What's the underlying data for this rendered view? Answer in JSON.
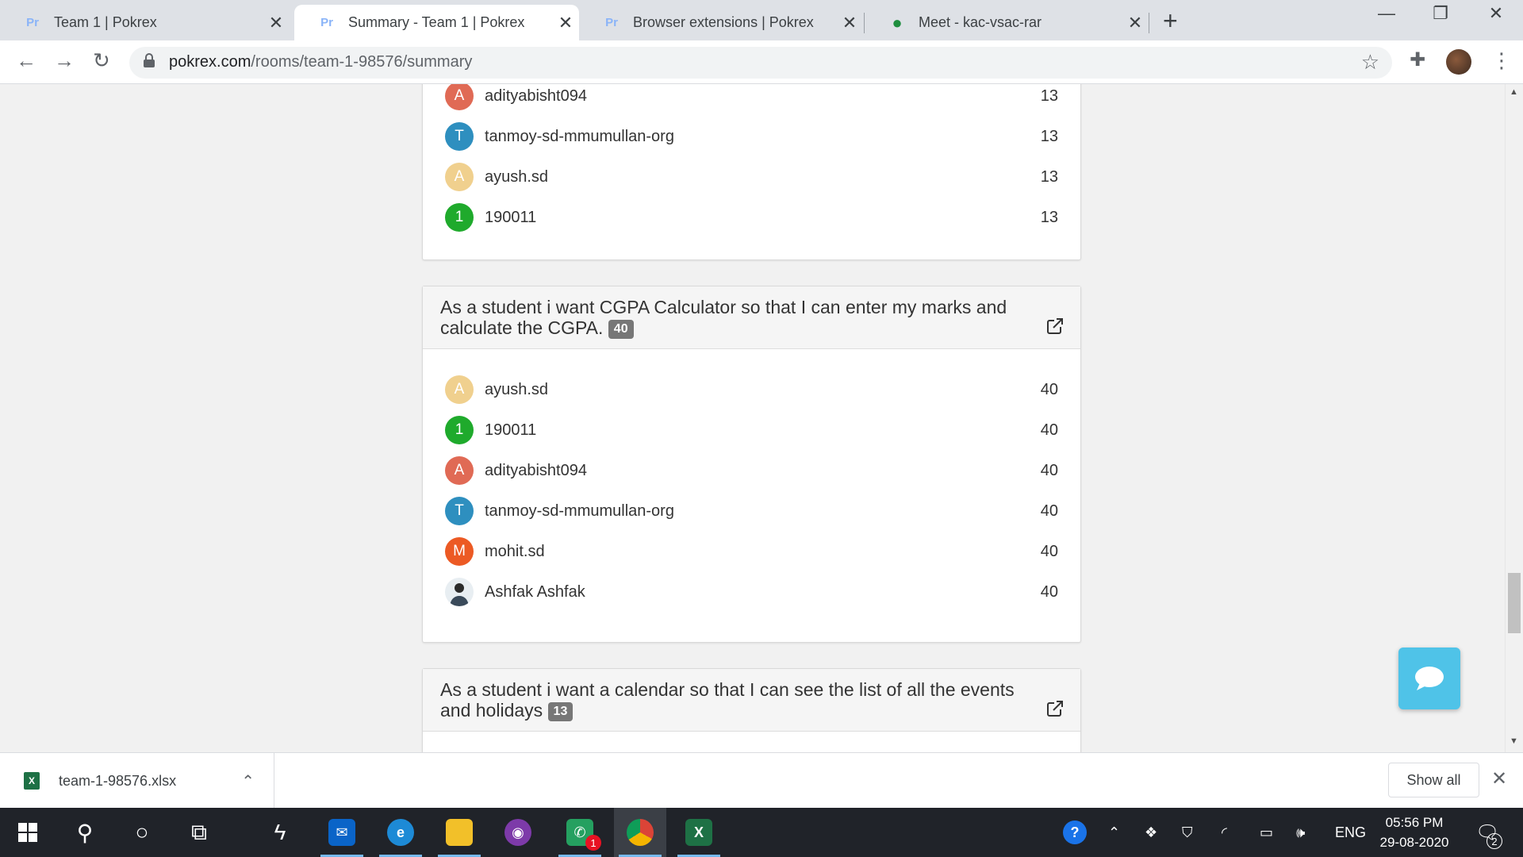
{
  "browser": {
    "tabs": [
      {
        "label": "Team 1 | Pokrex",
        "favicon": "Pr",
        "active": false
      },
      {
        "label": "Summary - Team 1 | Pokrex",
        "favicon": "Pr",
        "active": true
      },
      {
        "label": "Browser extensions | Pokrex",
        "favicon": "Pr",
        "active": false
      },
      {
        "label": "Meet - kac-vsac-rar",
        "favicon": "meet-icon",
        "active": false
      }
    ],
    "url_domain": "pokrex.com",
    "url_path": "/rooms/team-1-98576/summary"
  },
  "stories": [
    {
      "title": "",
      "points": "",
      "votes": [
        {
          "initial": "A",
          "color": "#e06a55",
          "name": "adityabisht094",
          "score": "13"
        },
        {
          "initial": "T",
          "color": "#2e8fbf",
          "name": "tanmoy-sd-mmumullan-org",
          "score": "13"
        },
        {
          "initial": "A",
          "color": "#f0d08e",
          "name": "ayush.sd",
          "score": "13"
        },
        {
          "initial": "1",
          "color": "#1faa2c",
          "name": "190011",
          "score": "13"
        }
      ]
    },
    {
      "title": "As a student i want CGPA Calculator so that I can enter my marks and calculate the CGPA.",
      "points": "40",
      "votes": [
        {
          "initial": "A",
          "color": "#f0d08e",
          "name": "ayush.sd",
          "score": "40"
        },
        {
          "initial": "1",
          "color": "#1faa2c",
          "name": "190011",
          "score": "40"
        },
        {
          "initial": "A",
          "color": "#e06a55",
          "name": "adityabisht094",
          "score": "40"
        },
        {
          "initial": "T",
          "color": "#2e8fbf",
          "name": "tanmoy-sd-mmumullan-org",
          "score": "40"
        },
        {
          "initial": "M",
          "color": "#ec5a24",
          "name": "mohit.sd",
          "score": "40"
        },
        {
          "initial": "",
          "color": "#e8eef2",
          "name": "Ashfak Ashfak",
          "score": "40"
        }
      ]
    },
    {
      "title": "As a student i want a calendar so that I can see the list of all the events and holidays",
      "points": "13",
      "votes": []
    }
  ],
  "downloads": {
    "file_name": "team-1-98576.xlsx",
    "show_all_label": "Show all"
  },
  "taskbar": {
    "language": "ENG",
    "time": "05:56 PM",
    "date": "29-08-2020",
    "whatsapp_badge": "1",
    "notifications_badge": "2"
  }
}
